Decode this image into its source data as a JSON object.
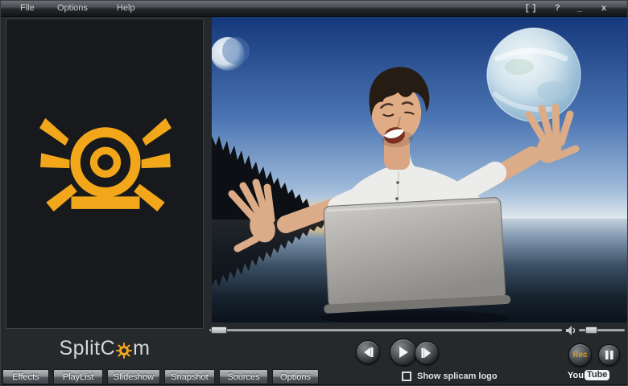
{
  "menu": {
    "items": [
      {
        "label": "File"
      },
      {
        "label": "Options"
      },
      {
        "label": "Help"
      }
    ]
  },
  "window_controls": {
    "fullscreen": "[ ]",
    "help": "?",
    "minimize": "_",
    "close": "x"
  },
  "logo": {
    "before": "SplitC",
    "after": "m"
  },
  "transport": {
    "rec_label": "Rec",
    "seek_position": 0.01,
    "volume_level": 0.2
  },
  "tabs": [
    {
      "label": "Effects"
    },
    {
      "label": "PlayList"
    },
    {
      "label": "Slideshow"
    },
    {
      "label": "Snapshot"
    },
    {
      "label": "Sources"
    },
    {
      "label": "Options"
    }
  ],
  "footer": {
    "logo_checkbox": {
      "label": "Show splicam logo",
      "checked": false
    },
    "youtube": {
      "you": "You",
      "tube": "Tube"
    }
  },
  "icons": {
    "webcam": "webcam-rays-icon",
    "logo_sun": "sun-icon",
    "speaker": "speaker-icon",
    "previous": "prev-track-icon",
    "play": "play-icon",
    "next": "next-track-icon",
    "pause": "pause-icon"
  },
  "colors": {
    "accent_orange": "#F2A71B",
    "rec_text": "#D79A2B"
  }
}
